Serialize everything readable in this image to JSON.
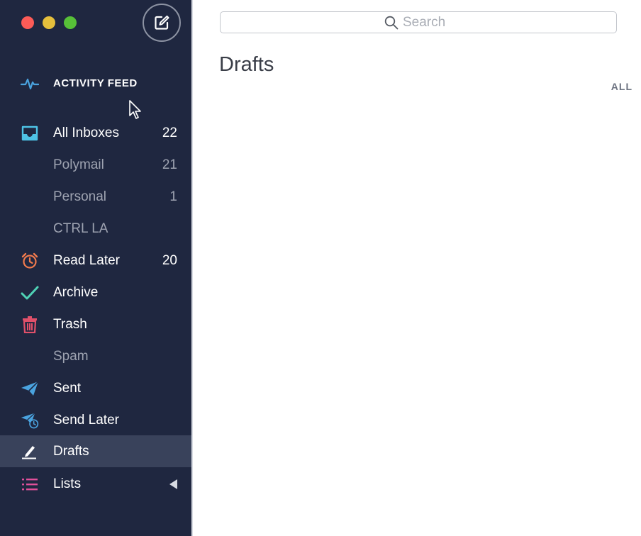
{
  "window": {
    "colors": {
      "sidebar_bg": "#1f2740",
      "active_bg": "#39425b",
      "accent": "#4aa3df"
    }
  },
  "sidebar": {
    "compose_icon": "compose-icon",
    "feed": {
      "label": "ACTIVITY FEED",
      "icon": "pulse-icon"
    },
    "all_inboxes": {
      "label": "All Inboxes",
      "count": "22",
      "icon": "inbox-icon"
    },
    "accounts": [
      {
        "label": "Polymail",
        "count": "21"
      },
      {
        "label": "Personal",
        "count": "1"
      },
      {
        "label": "CTRL LA",
        "count": ""
      }
    ],
    "read_later": {
      "label": "Read Later",
      "count": "20",
      "icon": "alarm-clock-icon"
    },
    "archive": {
      "label": "Archive",
      "icon": "checkmark-icon"
    },
    "trash": {
      "label": "Trash",
      "icon": "trash-icon"
    },
    "spam": {
      "label": "Spam"
    },
    "sent": {
      "label": "Sent",
      "icon": "paper-plane-icon"
    },
    "send_later": {
      "label": "Send Later",
      "icon": "paper-plane-clock-icon"
    },
    "drafts": {
      "label": "Drafts",
      "icon": "pencil-icon"
    },
    "lists": {
      "label": "Lists",
      "icon": "list-icon"
    }
  },
  "main": {
    "search": {
      "placeholder": "Search"
    },
    "title": "Drafts",
    "filter": "ALL"
  }
}
